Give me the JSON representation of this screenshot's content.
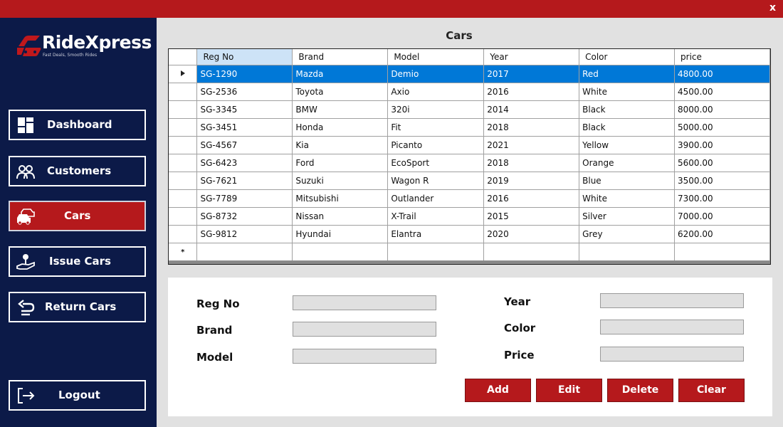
{
  "window": {
    "close_label": "x"
  },
  "brand": {
    "name": "RideXpress",
    "tagline": "Fast Deals, Smooth Rides",
    "accent": "#b5191c",
    "sidebar_color": "#0c1a48"
  },
  "sidebar": {
    "items": [
      {
        "label": "Dashboard",
        "icon": "dashboard-icon",
        "active": false
      },
      {
        "label": "Customers",
        "icon": "customers-icon",
        "active": false
      },
      {
        "label": "Cars",
        "icon": "cars-icon",
        "active": true
      },
      {
        "label": "Issue Cars",
        "icon": "issue-cars-icon",
        "active": false
      },
      {
        "label": "Return Cars",
        "icon": "return-cars-icon",
        "active": false
      }
    ],
    "logout": {
      "label": "Logout",
      "icon": "logout-icon"
    }
  },
  "main": {
    "title": "Cars",
    "table": {
      "columns": [
        "Reg No",
        "Brand",
        "Model",
        "Year",
        "Color",
        "price"
      ],
      "rows": [
        [
          "SG-1290",
          "Mazda",
          "Demio",
          "2017",
          "Red",
          "4800.00"
        ],
        [
          "SG-2536",
          "Toyota",
          "Axio",
          "2016",
          "White",
          "4500.00"
        ],
        [
          "SG-3345",
          "BMW",
          "320i",
          "2014",
          "Black",
          "8000.00"
        ],
        [
          "SG-3451",
          "Honda",
          "Fit",
          "2018",
          "Black",
          "5000.00"
        ],
        [
          "SG-4567",
          "Kia",
          "Picanto",
          "2021",
          "Yellow",
          "3900.00"
        ],
        [
          "SG-6423",
          "Ford",
          "EcoSport",
          "2018",
          "Orange",
          "5600.00"
        ],
        [
          "SG-7621",
          "Suzuki",
          "Wagon R",
          "2019",
          "Blue",
          "3500.00"
        ],
        [
          "SG-7789",
          "Mitsubishi",
          "Outlander",
          "2016",
          "White",
          "7300.00"
        ],
        [
          "SG-8732",
          "Nissan",
          "X-Trail",
          "2015",
          "Silver",
          "7000.00"
        ],
        [
          "SG-9812",
          "Hyundai",
          "Elantra",
          "2020",
          "Grey",
          "6200.00"
        ]
      ],
      "selected_row": 0,
      "new_row_marker": "*"
    },
    "form": {
      "reg_no_label": "Reg No",
      "reg_no_value": "",
      "brand_label": "Brand",
      "brand_value": "",
      "model_label": "Model",
      "model_value": "",
      "year_label": "Year",
      "year_value": "",
      "color_label": "Color",
      "color_value": "",
      "price_label": "Price",
      "price_value": ""
    },
    "actions": {
      "add": "Add",
      "edit": "Edit",
      "delete": "Delete",
      "clear": "Clear"
    }
  }
}
